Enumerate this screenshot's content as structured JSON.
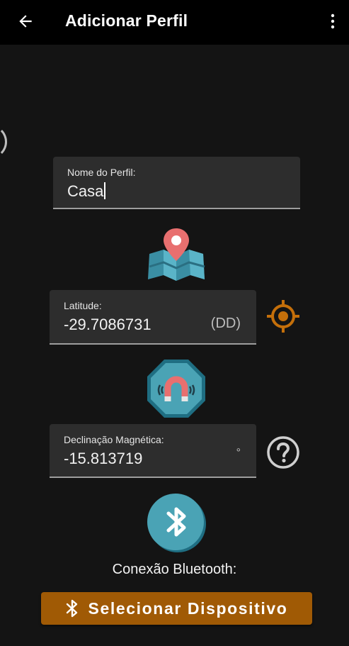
{
  "appbar": {
    "title": "Adicionar Perfil",
    "back_icon": "arrow-left-icon",
    "menu_icon": "more-vertical-icon"
  },
  "profile_name": {
    "label": "Nome do Perfil:",
    "value": "Casa"
  },
  "latitude": {
    "label": "Latitude:",
    "value": "-29.7086731",
    "suffix": "(DD)"
  },
  "declination": {
    "label": "Declinação Magnética:",
    "value": "-15.813719",
    "suffix": "°"
  },
  "bluetooth": {
    "label": "Conexão Bluetooth:",
    "button_label": "Selecionar Dispositivo",
    "button_color": "#a05a05"
  },
  "icons": {
    "map": "map-pin-icon",
    "gps": "gps-target-icon",
    "magnet": "magnet-icon",
    "help": "help-circle-icon",
    "bluetooth": "bluetooth-icon"
  },
  "colors": {
    "background": "#141414",
    "appbar": "#000000",
    "field_bg": "#2d2d2d",
    "accent_orange": "#c46f0a",
    "teal": "#4aa3b5"
  }
}
